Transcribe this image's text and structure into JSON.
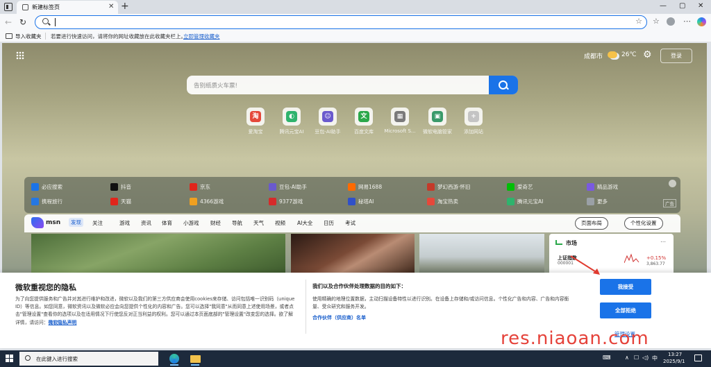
{
  "browser": {
    "tab_title": "新建标签页",
    "tab_close": "✕",
    "new_tab": "+",
    "window_controls": [
      "—",
      "▢",
      "✕"
    ],
    "address_value": "",
    "star": "☆",
    "favorites": "☆",
    "more": "⋯"
  },
  "favbar": {
    "import": "导入收藏夹",
    "message": "若要进行快速访问，请将你的网址收藏放在此收藏夹栏上。",
    "manage_link": "立即管理收藏夹"
  },
  "newtab": {
    "weather_city": "成都市",
    "weather_temp": "26℃",
    "login": "登录",
    "search_placeholder": "告别纸质火车票!",
    "shortcuts": [
      {
        "label": "爱淘宝",
        "glyph": "淘",
        "color": "#e5483a"
      },
      {
        "label": "腾讯元宝AI",
        "glyph": "◐",
        "color": "#2fb36d"
      },
      {
        "label": "豆包-AI助手",
        "glyph": "☺",
        "color": "#6a5acd"
      },
      {
        "label": "百度文库",
        "glyph": "文",
        "color": "#2aa84a"
      },
      {
        "label": "Microsoft S...",
        "glyph": "▦",
        "color": "#7a7a7a"
      },
      {
        "label": "微软电脑管家",
        "glyph": "▣",
        "color": "#3a9a6a"
      },
      {
        "label": "添加网站",
        "glyph": "+",
        "color": "#c4c4c4"
      }
    ],
    "quick_links": [
      {
        "label": "必应搜索",
        "color": "#1a73e8"
      },
      {
        "label": "抖音",
        "color": "#111111"
      },
      {
        "label": "京东",
        "color": "#e1251b"
      },
      {
        "label": "豆包-AI助手",
        "color": "#6a5acd"
      },
      {
        "label": "网易1688",
        "color": "#ff6a00"
      },
      {
        "label": "梦幻西游·怀旧",
        "color": "#c43a2a"
      },
      {
        "label": "爱奇艺",
        "color": "#00be06"
      },
      {
        "label": "精品游戏",
        "color": "#7a5ae0"
      },
      {
        "label": "携程旅行",
        "color": "#2577e3"
      },
      {
        "label": "天猫",
        "color": "#e1251b"
      },
      {
        "label": "4366游戏",
        "color": "#f0a020"
      },
      {
        "label": "9377游戏",
        "color": "#d62a2a"
      },
      {
        "label": "秘塔AI",
        "color": "#3050c8"
      },
      {
        "label": "淘宝热卖",
        "color": "#e5483a"
      },
      {
        "label": "腾讯元宝AI",
        "color": "#2fb36d"
      },
      {
        "label": "更多",
        "color": "#9aa0a6"
      }
    ],
    "ad": "广告"
  },
  "msn": {
    "logo": "msn",
    "nav": [
      "发现",
      "关注",
      "游戏",
      "资讯",
      "体育",
      "小游戏",
      "财经",
      "导航",
      "天气",
      "视频",
      "AI大全",
      "日历",
      "考试"
    ],
    "layout_button": "页面布局",
    "personalize_button": "个性化设置",
    "market_title": "市场",
    "market_more": "⋯",
    "index_name": "上证指数",
    "index_code": "000001",
    "index_change": "+0.15%",
    "index_value": "3,863.77"
  },
  "consent": {
    "title": "微软重视您的隐私",
    "body": "为了向您提供服务和广告并对其进行维护和改进，微软以及我们的第三方供应商会使用cookies来存储、访问包括唯一识别码（unique ID）等信息。如您同意，微软资讯以及微软必应会向您提供个性化的内容和广告。您可以选择\"我同意\"从而同意上述使用场景，或者点击\"管理设置\"查看你的选项以及在适用情况下行使您反对正当利益的权利。您可以通过本页面底部的\"管理设置\"改变您的选择。欲了解详情，请访问：",
    "privacy_link": "微软隐私声明",
    "title2": "我们以及合作伙伴处理数据的目的如下：",
    "body2": "使用精确的地理位置数据，主动扫描设备特性以进行识别。在设备上存储和/或访问信息。个性化广告和内容、广告和内容衡量、受众研究和服务开发。",
    "partners": "合作伙伴（供应商）名单",
    "accept": "我接受",
    "reject": "全部拒绝",
    "manage": "管理设置"
  },
  "watermark": "res.niaoan.com",
  "taskbar": {
    "search": "在此键入进行搜索",
    "ime": "中",
    "time": "13:27",
    "date": "2025/9/1"
  }
}
